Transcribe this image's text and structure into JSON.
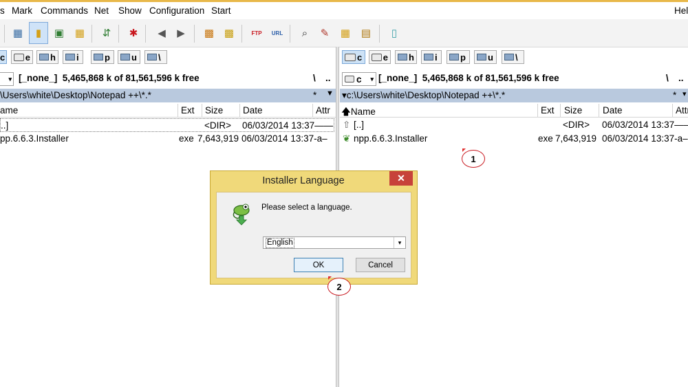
{
  "menu": {
    "items": [
      "s",
      "Mark",
      "Commands",
      "Net",
      "Show",
      "Configuration",
      "Start"
    ],
    "help": "Hel"
  },
  "left_panel": {
    "drives": [
      "c",
      "e",
      "h",
      "i",
      "p",
      "u",
      "\\"
    ],
    "drive_combo": "",
    "free_space": "[_none_]  5,465,868 k of 81,561,596 k free",
    "root_btn": "\\",
    "up_btn": "..",
    "path": "\\Users\\white\\Desktop\\Notepad ++\\*.*",
    "filter": "*",
    "columns": {
      "name": "ame",
      "ext": "Ext",
      "size": "Size",
      "date": "Date",
      "attr": "Attr"
    },
    "rows": [
      {
        "name": "..]",
        "ext": "",
        "size": "<DIR>",
        "date": "06/03/2014 13:37——"
      },
      {
        "name": "pp.6.6.3.Installer",
        "ext": "exe",
        "size": "7,643,919",
        "date": "06/03/2014 13:37-a–"
      }
    ]
  },
  "right_panel": {
    "drives": [
      "c",
      "e",
      "h",
      "i",
      "p",
      "u",
      "\\"
    ],
    "drive_combo": "c",
    "free_space": "[_none_]  5,465,868 k of 81,561,596 k free",
    "root_btn": "\\",
    "up_btn": "..",
    "path": "▾c:\\Users\\white\\Desktop\\Notepad ++\\*.*",
    "filter": "*",
    "columns": {
      "name": "🡅Name",
      "ext": "Ext",
      "size": "Size",
      "date": "Date",
      "attr": "Attr"
    },
    "rows": [
      {
        "name": "[..]",
        "ext": "",
        "size": "<DIR>",
        "date": "06/03/2014 13:37——"
      },
      {
        "name": "npp.6.6.3.Installer",
        "ext": "exe",
        "size": "7,643,919",
        "date": "06/03/2014 13:37-a–"
      }
    ]
  },
  "dialog": {
    "title": "Installer Language",
    "close": "✕",
    "message": "Please select a language.",
    "selected_language": "English",
    "ok_label": "OK",
    "cancel_label": "Cancel"
  },
  "markers": {
    "one": "1",
    "two": "2"
  },
  "colors": {
    "accent": "#e8b84a",
    "path_bar": "#b9c9de",
    "dialog_frame": "#f0d97a",
    "close": "#c7423a",
    "marker": "#c8161d"
  }
}
